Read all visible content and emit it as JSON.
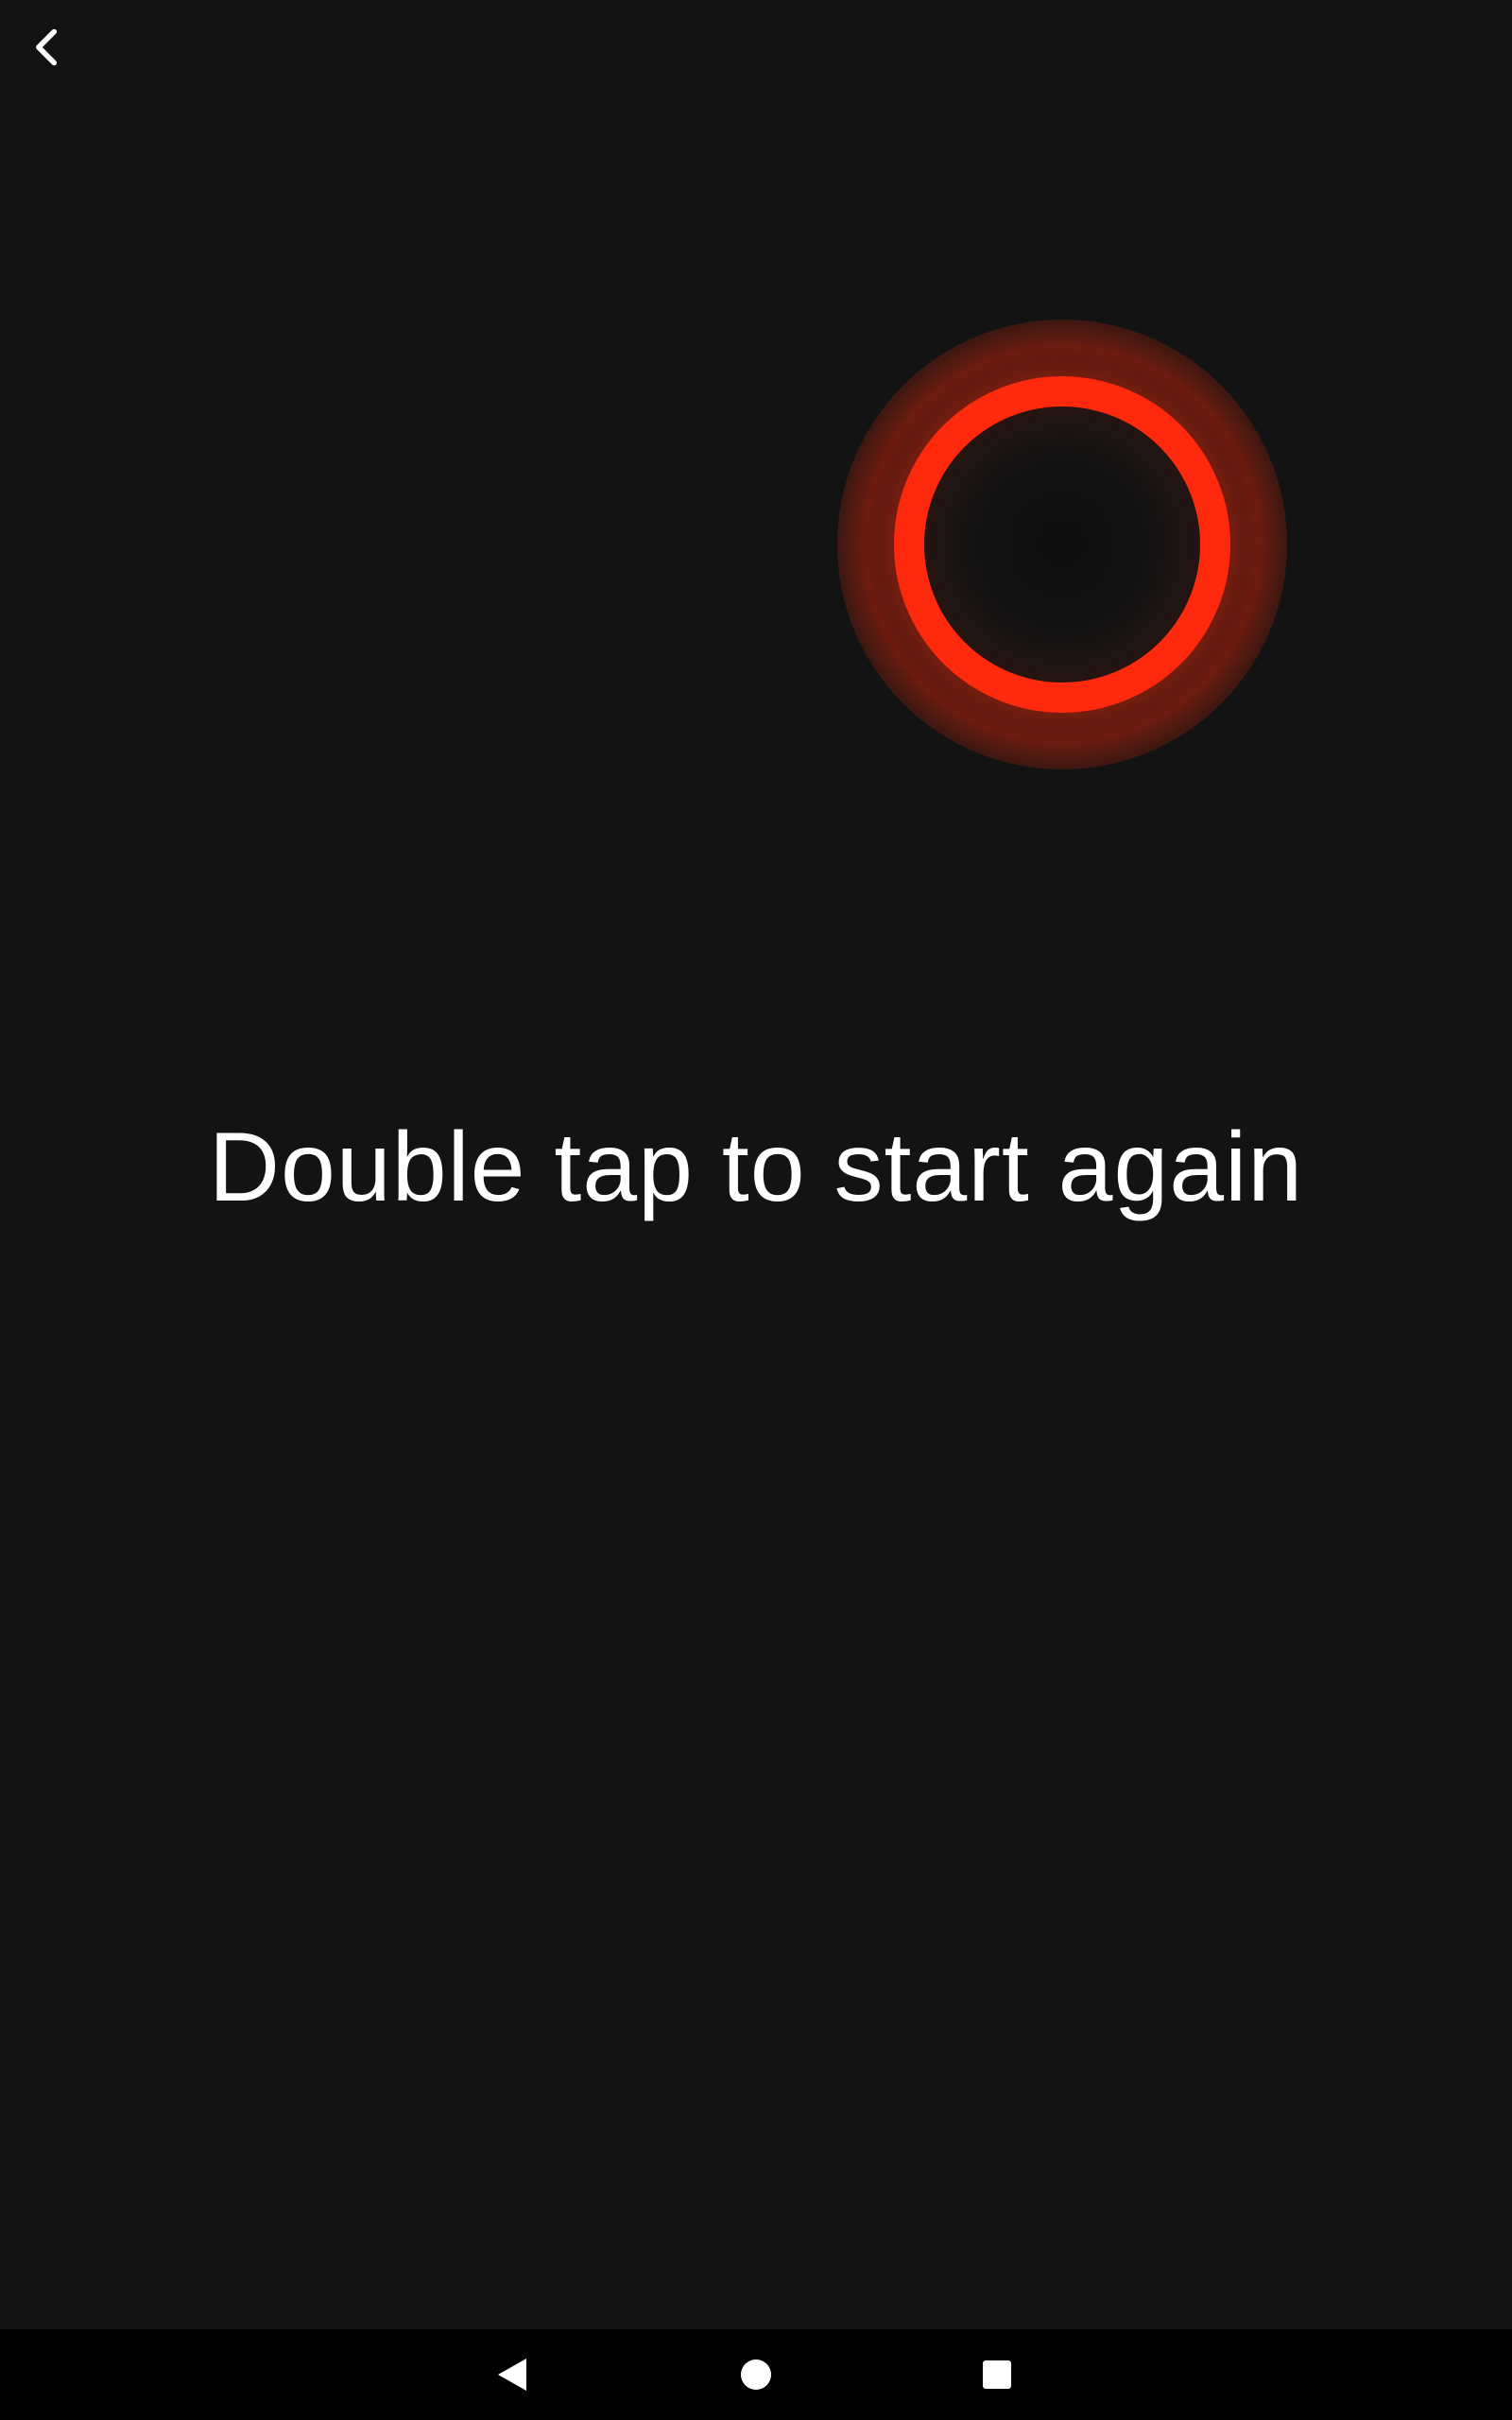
{
  "toolbar": {
    "back_icon": "chevron-left-icon"
  },
  "indicator": {
    "icon": "ring-icon",
    "color": "#ff2a0e"
  },
  "main": {
    "message": "Double tap to start again"
  },
  "system_nav": {
    "back_icon": "triangle-back-icon",
    "home_icon": "circle-home-icon",
    "recents_icon": "square-recents-icon"
  },
  "colors": {
    "background": "#131313",
    "text": "#ffffff",
    "nav_bar": "#000000",
    "accent": "#ff2a0e"
  }
}
